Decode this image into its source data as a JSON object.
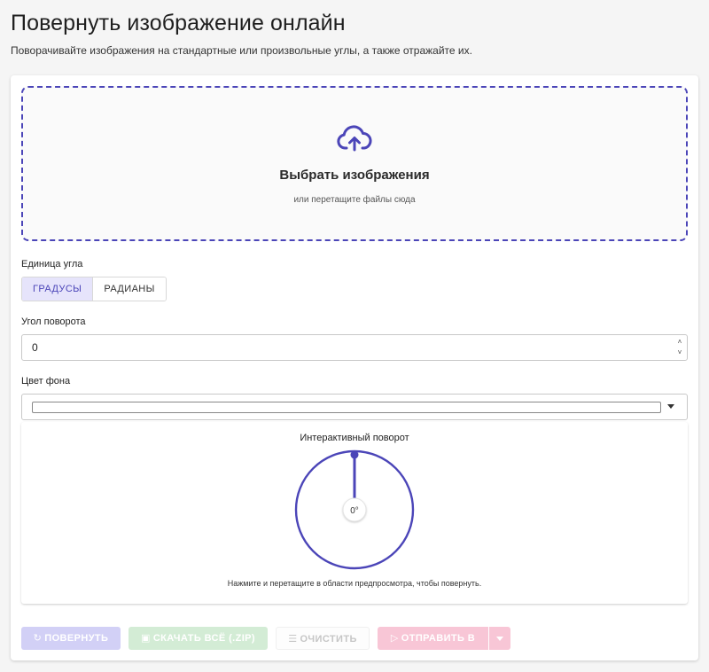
{
  "header": {
    "title": "Повернуть изображение онлайн",
    "subtitle": "Поворачивайте изображения на стандартные или произвольные углы, а также отражайте их."
  },
  "dropzone": {
    "icon": "cloud-upload-icon",
    "title": "Выбрать изображения",
    "hint": "или перетащите файлы сюда"
  },
  "angle_unit": {
    "label": "Единица угла",
    "options": [
      "ГРАДУСЫ",
      "РАДИАНЫ"
    ],
    "selected": "ГРАДУСЫ"
  },
  "rotation_angle": {
    "label": "Угол поворота",
    "value": "0"
  },
  "background_color": {
    "label": "Цвет фона",
    "value": "#ffffff"
  },
  "preview": {
    "title": "Интерактивный поворот",
    "angle_readout": "0°",
    "angle_degrees": 0,
    "hint": "Нажмите и перетащите в области предпросмотра, чтобы повернуть."
  },
  "actions": {
    "rotate": "ПОВЕРНУТЬ",
    "download_zip": "СКАЧАТЬ ВСЁ (.ZIP)",
    "clear": "ОЧИСТИТЬ",
    "send_to": "ОТПРАВИТЬ В"
  },
  "colors": {
    "accent": "#4b45b8",
    "rotate_disabled": "#d2d0f6",
    "zip_disabled": "#d3ecd5",
    "send_disabled": "#f8c6d6",
    "background": "#f5f5f5"
  }
}
